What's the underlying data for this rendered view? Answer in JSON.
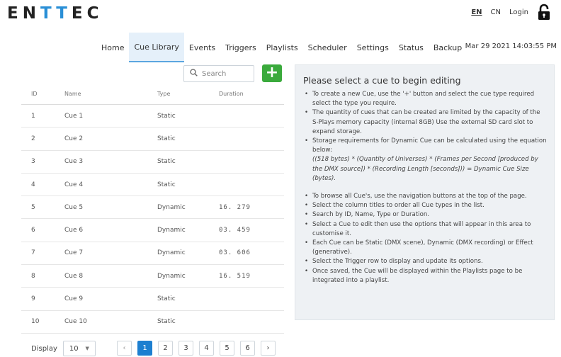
{
  "brand": {
    "logo": [
      "E",
      "N",
      "T",
      "T",
      "E",
      "C"
    ]
  },
  "top": {
    "lang_en": "EN",
    "lang_cn": "CN",
    "login": "Login"
  },
  "nav": {
    "tabs": [
      "Home",
      "Cue Library",
      "Events",
      "Triggers",
      "Playlists",
      "Scheduler",
      "Settings",
      "Status",
      "Backup"
    ],
    "active": "Cue Library",
    "datetime": "Mar 29 2021 14:03:55 PM"
  },
  "search": {
    "placeholder": "Search"
  },
  "add_button": {
    "label": "+"
  },
  "table": {
    "headers": {
      "id": "ID",
      "name": "Name",
      "type": "Type",
      "duration": "Duration"
    },
    "rows": [
      {
        "id": "1",
        "name": "Cue 1",
        "type": "Static",
        "duration": ""
      },
      {
        "id": "2",
        "name": "Cue 2",
        "type": "Static",
        "duration": ""
      },
      {
        "id": "3",
        "name": "Cue 3",
        "type": "Static",
        "duration": ""
      },
      {
        "id": "4",
        "name": "Cue 4",
        "type": "Static",
        "duration": ""
      },
      {
        "id": "5",
        "name": "Cue 5",
        "type": "Dynamic",
        "duration": "16. 279"
      },
      {
        "id": "6",
        "name": "Cue 6",
        "type": "Dynamic",
        "duration": "03. 459"
      },
      {
        "id": "7",
        "name": "Cue 7",
        "type": "Dynamic",
        "duration": "03. 606"
      },
      {
        "id": "8",
        "name": "Cue 8",
        "type": "Dynamic",
        "duration": "16. 519"
      },
      {
        "id": "9",
        "name": "Cue 9",
        "type": "Static",
        "duration": ""
      },
      {
        "id": "10",
        "name": "Cue 10",
        "type": "Static",
        "duration": ""
      }
    ]
  },
  "display": {
    "label": "Display",
    "value": "10"
  },
  "pager": {
    "prev": "‹",
    "next": "›",
    "pages": [
      "1",
      "2",
      "3",
      "4",
      "5",
      "6"
    ],
    "current": "1"
  },
  "panel": {
    "title": "Please select a cue to begin editing",
    "bullets_a": [
      "To create a new Cue, use the '+' button and select the cue type required select the type you require.",
      "The quantity of cues that can be created are limited by the capacity of the S-Plays memory capacity (internal 8GB) Use the external SD card slot to expand storage.",
      "Storage requirements for Dynamic Cue can be calculated using the equation below:"
    ],
    "equation": "((518 bytes) * (Quantity of Universes) * (Frames per Second [produced by the DMX source]) * (Recording Length [seconds])) = Dynamic Cue Size (bytes).",
    "bullets_b": [
      "To browse all Cue's, use the navigation buttons at the top of the page.",
      "Select the column titles to order all Cue types in the list.",
      "Search by ID, Name, Type or Duration.",
      "Select a Cue to edit then use the options that will appear in this area to customise it.",
      "Each Cue can be Static (DMX scene), Dynamic (DMX recording) or Effect (generative).",
      "Select the Trigger row to display and update its options.",
      "Once saved, the Cue will be displayed within the Playlists page to be integrated into a playlist."
    ]
  },
  "colors": {
    "accent": "#1d7fd0",
    "add": "#3aaa3c",
    "active_tab": "#e5f0fa",
    "logo_t": "#2a8fd6"
  }
}
